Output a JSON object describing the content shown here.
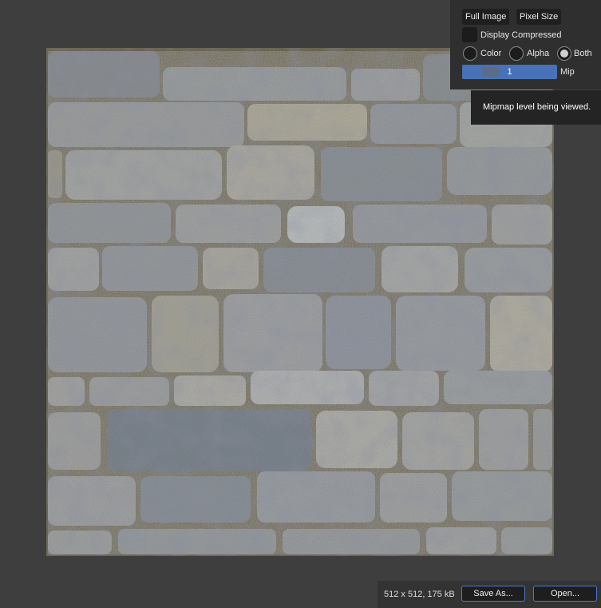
{
  "toolbar": {
    "full_image_label": "Full Image",
    "pixel_size_label": "Pixel Size",
    "display_compressed_label": "Display Compressed",
    "display_compressed_checked": false
  },
  "channels": {
    "options": [
      "Color",
      "Alpha",
      "Both"
    ],
    "selected": "Both"
  },
  "mip": {
    "value": "1",
    "label": "Mip"
  },
  "tooltip": {
    "text": "Mipmap level being viewed."
  },
  "footer": {
    "image_info": "512 x 512, 175 kB",
    "save_as_label": "Save As...",
    "open_label": "Open..."
  },
  "colors": {
    "accent": "#4872b8",
    "background": "#3e3e3e",
    "panel": "#2f2f2f"
  },
  "texture": {
    "description_icon": "stone-wall-texture-image"
  }
}
